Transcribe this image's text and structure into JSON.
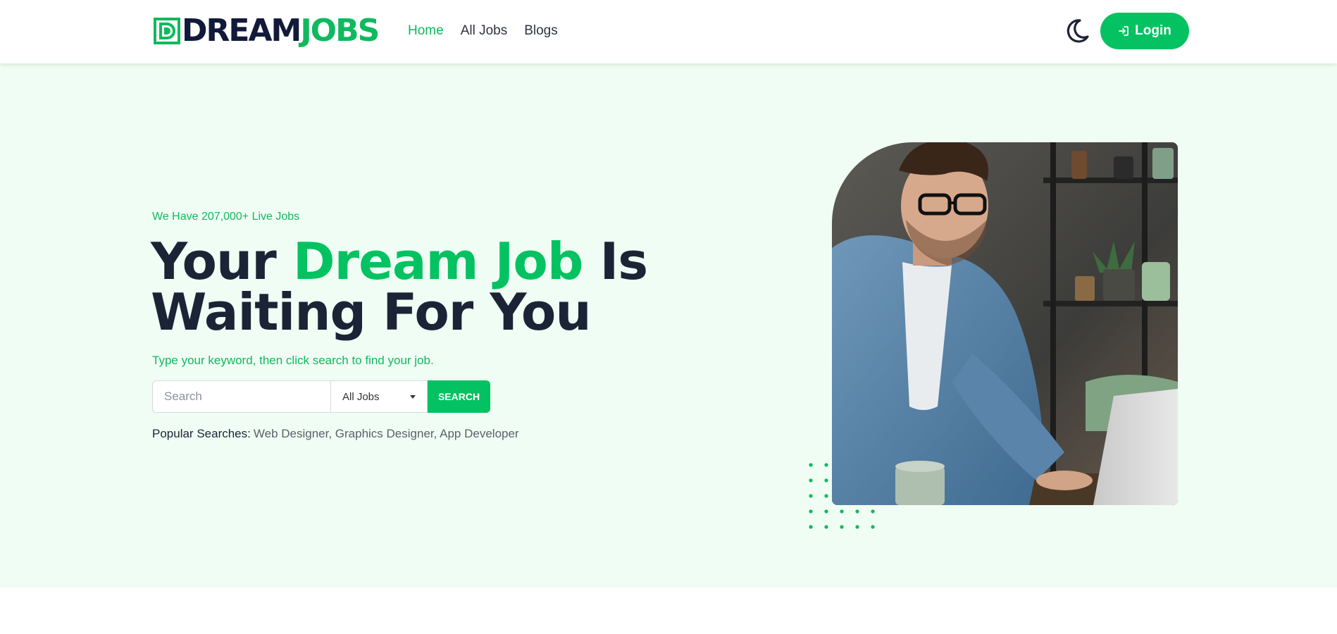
{
  "header": {
    "logo": {
      "part1": "DREAM",
      "part2": "JOBS"
    },
    "nav": [
      {
        "label": "Home",
        "active": true
      },
      {
        "label": "All Jobs",
        "active": false
      },
      {
        "label": "Blogs",
        "active": false
      }
    ],
    "theme_icon": "moon-icon",
    "login_icon": "login-arrow-icon",
    "login_label": "Login"
  },
  "hero": {
    "tagline": "We Have 207,000+ Live Jobs",
    "headline": {
      "part1": "Your ",
      "accent": "Dream Job",
      "part2": " Is",
      "line2": "Waiting For You"
    },
    "subline": "Type your keyword, then click search to find your job.",
    "search": {
      "placeholder": "Search",
      "category_selected": "All Jobs",
      "button_label": "SEARCH"
    },
    "popular": {
      "label": "Popular Searches:",
      "terms": "Web Designer, Graphics Designer, App Developer"
    },
    "image": "man-with-laptop-photo"
  },
  "colors": {
    "brand_green": "#04c261",
    "dark_navy": "#1b2436",
    "hero_bg": "#effdf4"
  }
}
